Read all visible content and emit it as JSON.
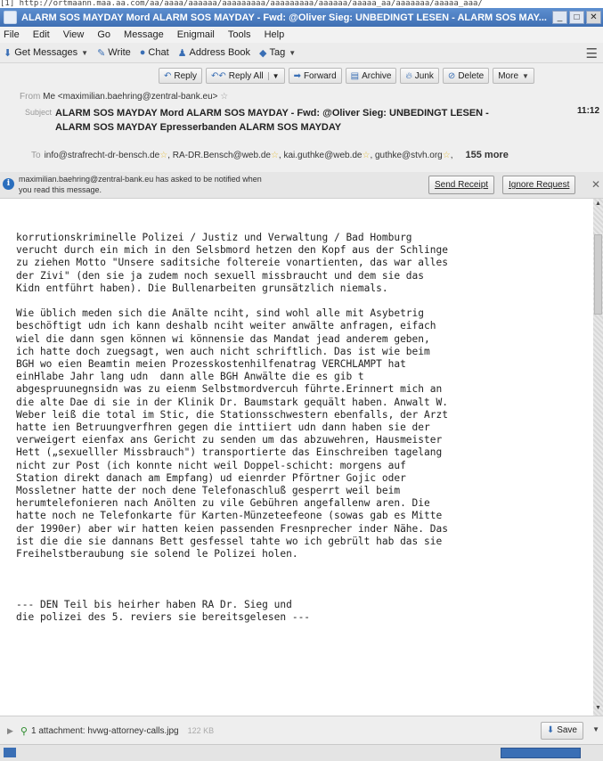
{
  "window": {
    "url": "[1] http://ortmaann.maa.aa.com/aa/aaaa/aaaaaa/aaaaaaaaa/aaaaaaaaa/aaaaaa/aaaaa_aa/aaaaaaa/aaaaa_aaa/",
    "title": "ALARM SOS MAYDAY Mord ALARM SOS MAYDAY - Fwd: @Oliver Sieg: UNBEDINGT LESEN - ALARM SOS MAY..."
  },
  "menu": [
    "File",
    "Edit",
    "View",
    "Go",
    "Message",
    "Enigmail",
    "Tools",
    "Help"
  ],
  "toolbar": {
    "get_messages": "Get Messages",
    "write": "Write",
    "chat": "Chat",
    "address_book": "Address Book",
    "tag": "Tag"
  },
  "actions": {
    "reply": "Reply",
    "reply_all": "Reply All",
    "forward": "Forward",
    "archive": "Archive",
    "junk": "Junk",
    "delete": "Delete",
    "more": "More"
  },
  "header": {
    "from_label": "From",
    "from_value": "Me <maximilian.baehring@zentral-bank.eu>",
    "subject_label": "Subject",
    "subject": "ALARM SOS MAYDAY Mord ALARM SOS MAYDAY - Fwd: @Oliver Sieg: UNBEDINGT LESEN - ALARM SOS MAYDAY Epresserbanden ALARM SOS MAYDAY",
    "time": "11:12",
    "to_label": "To",
    "to_recipients": [
      "info@strafrecht-dr-bensch.de",
      "RA-DR.Bensch@web.de",
      "kai.guthke@web.de",
      "guthke@stvh.org"
    ],
    "more": "155 more"
  },
  "notification": {
    "message": "maximilian.baehring@zentral-bank.eu has asked to be notified when you read this message.",
    "send_receipt": "Send Receipt",
    "ignore_request": "Ignore Request"
  },
  "body_text": "korrutionskriminelle Polizei / Justiz und Verwaltung / Bad Homburg\nverucht durch ein mich in den Selsbmord hetzen den Kopf aus der Schlinge\nzu ziehen Motto \"Unsere saditsiche foltereie vonartienten, das war alles\nder Zivi\" (den sie ja zudem noch sexuell missbraucht und dem sie das\nKidn entführt haben). Die Bullenarbeiten grunsätzlich niemals.\n\nWie üblich meden sich die Anälte nciht, sind wohl alle mit Asybetrig\nbeschöftigt udn ich kann deshalb nciht weiter anwälte anfragen, eifach\nwiel die dann sgen können wi könnensie das Mandat jead anderem geben,\nich hatte doch zuegsagt, wen auch nicht schriftlich. Das ist wie beim\nBGH wo eien Beamtin meien Prozesskostenhilfenatrag VERCHLAMPT hat\neinHlabe Jahr lang udn  dann alle BGH Anwälte die es gib t\nabgespruunegnsidn was zu eienm Selbstmordvercuh führte.Erinnert mich an\ndie alte Dae di sie in der Klinik Dr. Baumstark gequält haben. Anwalt W.\nWeber leiß die total im Stic, die Stationsschwestern ebenfalls, der Arzt\nhatte ien Betruungverfhren gegen die inttiiert udn dann haben sie der\nverweigert eienfax ans Gericht zu senden um das abzuwehren, Hausmeister\nHett („sexuelller Missbrauch\") transportierte das Einschreiben tagelang\nnicht zur Post (ich konnte nicht weil Doppel-schicht: morgens auf\nStation direkt danach am Empfang) ud eienrder Pförtner Gojic oder\nMossletner hatte der noch dene Telefonaschluß gesperrt weil beim\nherumtelefonieren nach Anölten zu vile Gebühren angefallenw aren. Die\nhatte noch ne Telefonkarte für Karten-Münzeteefeone (sowas gab es Mitte\nder 1990er) aber wir hatten keien passenden Fresnprecher inder Nähe. Das\nist die die sie dannans Bett gesfessel tahte wo ich gebrült hab das sie\nFreihelstberaubung sie solend le Polizei holen.\n\n\n\n--- DEN Teil bis heirher haben RA Dr. Sieg und\ndie polizei des 5. reviers sie bereitsgelesen ---",
  "attachment": {
    "label": "1 attachment: hvwg-attorney-calls.jpg",
    "size": "122 KB",
    "save": "Save"
  }
}
